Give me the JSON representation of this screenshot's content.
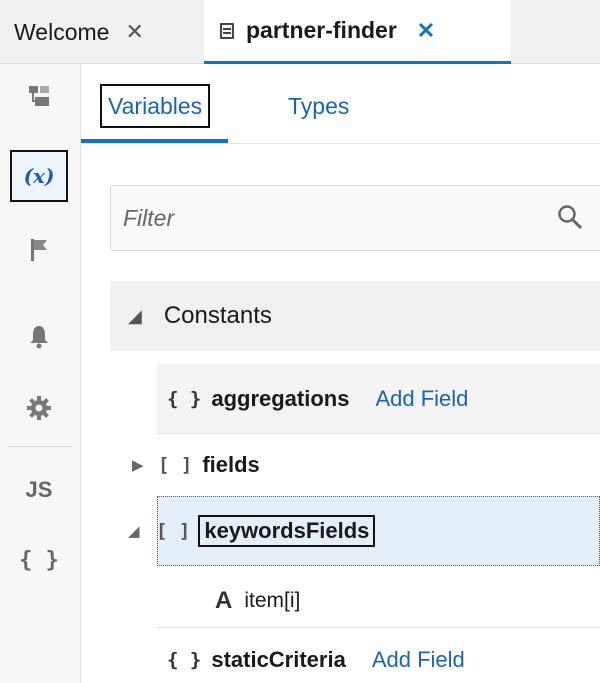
{
  "tabs": {
    "welcome": "Welcome",
    "active": "partner-finder",
    "close_glyph": "✕"
  },
  "subtabs": {
    "variables": "Variables",
    "types": "Types"
  },
  "rail": {
    "icons": [
      "structure-icon",
      "variables-icon",
      "flag-icon",
      "bell-icon",
      "gear-icon",
      "js-icon",
      "json-icon"
    ],
    "variables_label": "(x)",
    "js_label": "JS",
    "json_label": "{ }"
  },
  "filter": {
    "placeholder": "Filter",
    "value": ""
  },
  "tree": {
    "constants": "Constants",
    "aggregations": {
      "type": "{ }",
      "name": "aggregations",
      "action": "Add Field"
    },
    "fields": {
      "type": "[ ]",
      "name": "fields"
    },
    "keywordsFields": {
      "type": "[ ]",
      "name": "keywordsFields"
    },
    "item": {
      "type": "A",
      "name": "item[i]"
    },
    "staticCriteria": {
      "type": "{ }",
      "name": "staticCriteria",
      "action": "Add Field"
    }
  },
  "colors": {
    "accent": "#1a73b8",
    "link": "#1a64b0",
    "selected_row": "#e3eef7"
  }
}
